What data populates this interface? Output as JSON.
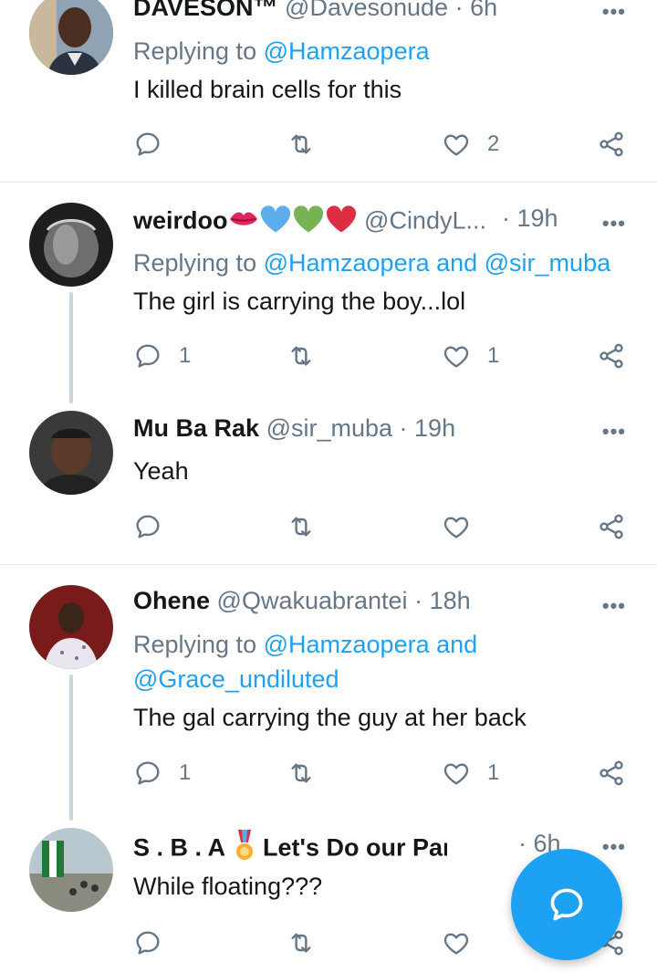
{
  "tweets": [
    {
      "name": "DAVESON™",
      "handle": "@Davesonude",
      "time": "· 6h",
      "replying_prefix": "Replying to",
      "replying_to": "@Hamzaopera",
      "text": "I killed brain cells for this",
      "reply_count": "",
      "like_count": "2"
    },
    {
      "name": "weirdoo",
      "handle": "@CindyL...",
      "time": "· 19h",
      "replying_prefix": "Replying to",
      "replying_to": "@Hamzaopera and @sir_muba",
      "text": "The girl is carrying the boy...lol",
      "reply_count": "1",
      "like_count": "1"
    },
    {
      "name": "Mu Ba Rak",
      "handle": "@sir_muba",
      "time": "· 19h",
      "text": "Yeah",
      "reply_count": "",
      "like_count": ""
    },
    {
      "name": "Ohene",
      "handle": "@Qwakuabrantei",
      "time": "· 18h",
      "replying_prefix": "Replying to",
      "replying_to_line1": "@Hamzaopera and",
      "replying_to_line2": "@Grace_undiluted",
      "text": "The gal carrying the guy at her back",
      "reply_count": "1",
      "like_count": "1"
    },
    {
      "name_part1": "S . B . A",
      "name_part2": "Let's Do our Part",
      "handle": "@...",
      "time": "· 6h",
      "text": "While floating???",
      "reply_count": "",
      "like_count": ""
    }
  ],
  "icons": {
    "reply": "reply-icon",
    "retweet": "retweet-icon",
    "like": "heart-icon",
    "share": "share-icon",
    "more": "more-icon",
    "compose": "compose-reply-icon"
  },
  "more_label": "•••",
  "colors": {
    "accent": "#1da1f2",
    "muted": "#657786"
  }
}
